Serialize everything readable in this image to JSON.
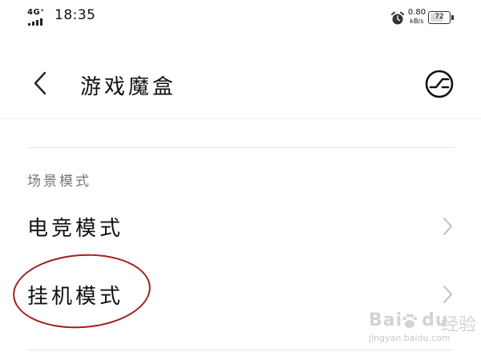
{
  "status_bar": {
    "network": "4G⁺",
    "time": "18:35",
    "net_speed_value": "0.80",
    "net_speed_unit": "kB/s",
    "battery_level": "72"
  },
  "header": {
    "back_icon": "chevron-left-icon",
    "title": "游戏魔盒",
    "action_icon": "hud-toggle-icon"
  },
  "section": {
    "label": "场景模式",
    "items": [
      {
        "label": "电竞模式",
        "icon": "chevron-right-icon"
      },
      {
        "label": "挂机模式",
        "icon": "chevron-right-icon"
      }
    ]
  },
  "annotation": {
    "color": "#a2201f",
    "target": "挂机模式"
  },
  "watermark": {
    "brand": "Bai",
    "brand2": "du",
    "product": "经验",
    "url": "jingyan.baidu.com"
  }
}
